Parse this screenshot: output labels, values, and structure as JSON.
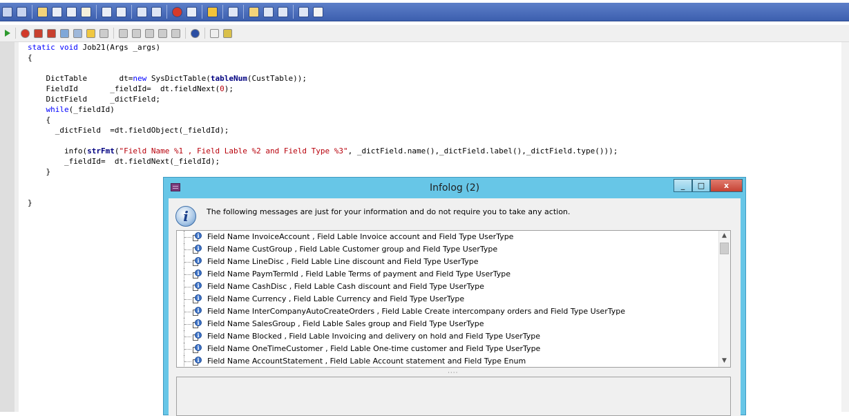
{
  "toolbar_top": {
    "icons": [
      "tree-icon",
      "arrow-icon",
      "folder-icon",
      "cut-icon",
      "copy-icon",
      "paste-icon",
      "find-icon",
      "replace-icon",
      "form-icon",
      "compile-icon",
      "stop-icon",
      "import-icon",
      "warning-icon",
      "table-icon",
      "grid-icon",
      "report-icon",
      "report2-icon",
      "export-icon",
      "doc-icon"
    ]
  },
  "toolbar_editor": {
    "icons": [
      "run-icon",
      "breakpoint-icon",
      "clear-breakpoints-icon",
      "breakpoint-list-icon",
      "debug-icon",
      "lookup-icon",
      "compile-icon",
      "copy-icon",
      "paste-icon",
      "duplicate-icon",
      "undo-icon",
      "redo-icon",
      "script-icon",
      "help-icon",
      "line-number-icon",
      "source-control-icon"
    ]
  },
  "code": {
    "line1_kw": "static void",
    "line1_rest": " Job21(Args _args)",
    "line2": "{",
    "line4_a": "    DictTable       dt=",
    "line4_kw": "new",
    "line4_b": " SysDictTable(",
    "line4_fn": "tableNum",
    "line4_c": "(CustTable));",
    "line5_a": "    FieldId       _fieldId=  dt.fieldNext(",
    "line5_num": "0",
    "line5_b": ");",
    "line6": "    DictField     _dictField;",
    "line7_kw": "    while",
    "line7_rest": "(_fieldId)",
    "line8": "    {",
    "line9": "      _dictField  =dt.fieldObject(_fieldId);",
    "line11_a": "        info(",
    "line11_fn": "strFmt",
    "line11_b": "(",
    "line11_str": "\"Field Name %1 , Field Lable %2 and Field Type %3\"",
    "line11_c": ", _dictField.name(),_dictField.label(),_dictField.type()));",
    "line12": "        _fieldId=  dt.fieldNext(_fieldId);",
    "line13": "    }",
    "line16": "}"
  },
  "infolog": {
    "title": "Infolog (2)",
    "minimize": "_",
    "maximize": "□",
    "close": "x",
    "header_message": "The following messages are just for your information and do not require you to take any action.",
    "info_glyph": "i",
    "items": [
      "Field Name InvoiceAccount , Field Lable Invoice account and Field Type UserType",
      "Field Name CustGroup , Field Lable Customer group and Field Type UserType",
      "Field Name LineDisc , Field Lable Line discount and Field Type UserType",
      "Field Name PaymTermId , Field Lable Terms of payment and Field Type UserType",
      "Field Name CashDisc , Field Lable Cash discount and Field Type UserType",
      "Field Name Currency , Field Lable Currency and Field Type UserType",
      "Field Name InterCompanyAutoCreateOrders , Field Lable Create intercompany orders and Field Type UserType",
      "Field Name SalesGroup , Field Lable Sales group and Field Type UserType",
      "Field Name Blocked , Field Lable Invoicing and delivery on hold and Field Type UserType",
      "Field Name OneTimeCustomer , Field Lable One-time customer and Field Type UserType",
      "Field Name AccountStatement , Field Lable Account statement and Field Type Enum"
    ],
    "scroll_up": "▲",
    "scroll_down": "▼",
    "splitter": "····"
  },
  "colors": {
    "keyword": "#0000ff",
    "string": "#b8000b",
    "window_frame": "#67c6e7"
  }
}
